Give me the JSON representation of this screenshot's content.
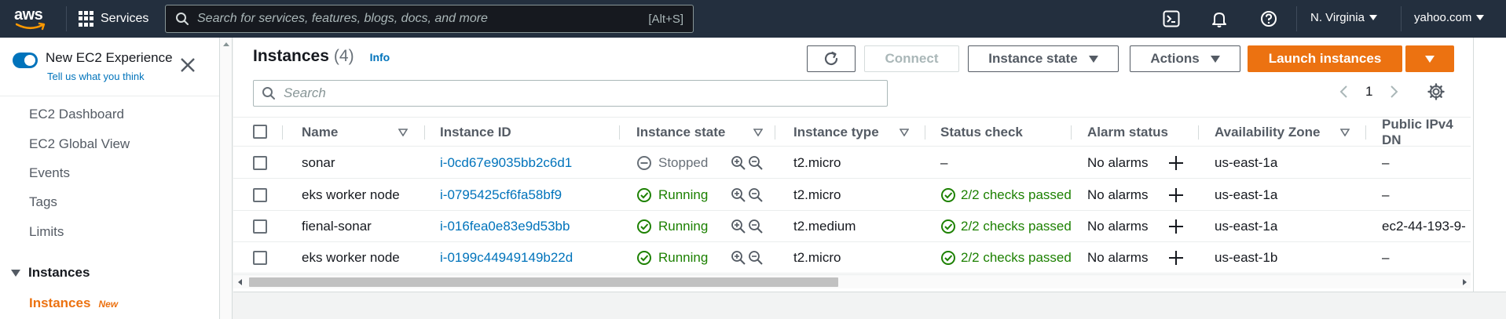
{
  "topnav": {
    "logo_text": "aws",
    "services_label": "Services",
    "search_placeholder": "Search for services, features, blogs, docs, and more",
    "search_shortcut": "[Alt+S]",
    "region_label": "N. Virginia",
    "account_label": "yahoo.com",
    "icons": [
      "cloudshell-icon",
      "bell-icon",
      "help-icon"
    ]
  },
  "sidebar": {
    "experience_title": "New EC2 Experience",
    "experience_link": "Tell us what you think",
    "toggle_on": true,
    "items": [
      "EC2 Dashboard",
      "EC2 Global View",
      "Events",
      "Tags",
      "Limits"
    ],
    "section_label": "Instances",
    "active_item": "Instances",
    "active_badge": "New"
  },
  "panel": {
    "title": "Instances",
    "count": "(4)",
    "info": "Info",
    "buttons": {
      "connect": "Connect",
      "instance_state": "Instance state",
      "actions": "Actions",
      "launch": "Launch instances"
    },
    "search_placeholder": "Search",
    "page_number": "1"
  },
  "table": {
    "columns": [
      "Name",
      "Instance ID",
      "Instance state",
      "Instance type",
      "Status check",
      "Alarm status",
      "Availability Zone",
      "Public IPv4 DN"
    ],
    "rows": [
      {
        "name": "sonar",
        "id": "i-0cd67e9035bb2c6d1",
        "state": "Stopped",
        "type": "t2.micro",
        "status": "–",
        "alarm": "No alarms",
        "zone": "us-east-1a",
        "ipv4": "–"
      },
      {
        "name": "eks worker node",
        "id": "i-0795425cf6fa58bf9",
        "state": "Running",
        "type": "t2.micro",
        "status": "2/2 checks passed",
        "alarm": "No alarms",
        "zone": "us-east-1a",
        "ipv4": "–"
      },
      {
        "name": "fienal-sonar",
        "id": "i-016fea0e83e9d53bb",
        "state": "Running",
        "type": "t2.medium",
        "status": "2/2 checks passed",
        "alarm": "No alarms",
        "zone": "us-east-1a",
        "ipv4": "ec2-44-193-9-"
      },
      {
        "name": "eks worker node",
        "id": "i-0199c44949149b22d",
        "state": "Running",
        "type": "t2.micro",
        "status": "2/2 checks passed",
        "alarm": "No alarms",
        "zone": "us-east-1b",
        "ipv4": "–"
      }
    ]
  },
  "colors": {
    "nav_bg": "#232f3e",
    "link": "#0073bb",
    "primary": "#ec7211",
    "success": "#1d8102"
  }
}
